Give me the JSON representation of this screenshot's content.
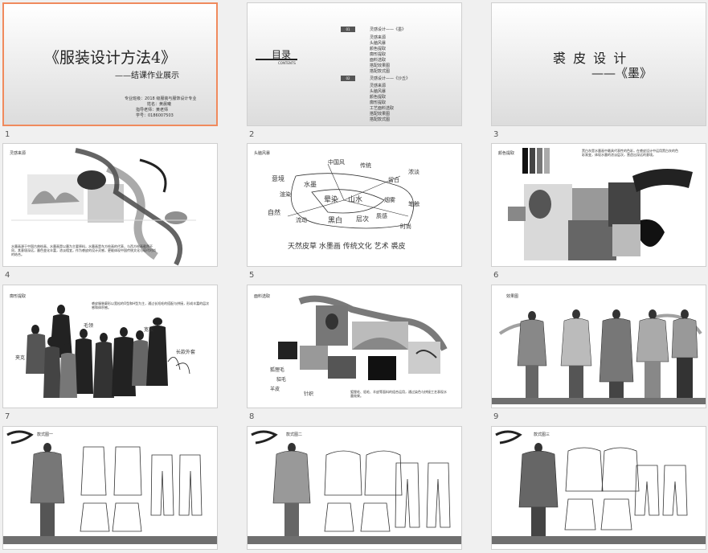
{
  "slides": [
    {
      "number": "1",
      "title": "《服装设计方法4》",
      "subtitle": "——结课作业展示",
      "info": [
        "专业班级：2018 级服装与服饰设计专业",
        "姓名：黄晨曦",
        "指导老师：黄老师",
        "学号：0186007503"
      ]
    },
    {
      "number": "2",
      "toc_title": "目录",
      "toc_en": "CONTENTS",
      "section1_num": "01",
      "section1_title": "灵感设计——《墨》",
      "section1_items": [
        "灵感来源",
        "头脑风暴",
        "颜色提取",
        "廓形提取",
        "面料选取",
        "搭配效果图",
        "搭配款式图"
      ],
      "section2_num": "02",
      "section2_title": "灵感设计——《沙丘》",
      "section2_items": [
        "灵感来源",
        "头脑风暴",
        "颜色提取",
        "廓形提取",
        "工艺面料选取",
        "搭配效果图",
        "搭配款式图"
      ]
    },
    {
      "number": "3",
      "title": "裘 皮 设 计",
      "subtitle": "——《墨》"
    },
    {
      "number": "4",
      "label": "灵感来源",
      "body": "水墨画源于中国古典绘画，水墨画是以墨为主要原料，水墨画是东方绘画的代表，与西方绘画截然不同，其意境深远，墨色变化丰富，浓淡相宜。作为裘皮的设计灵感，更能体现中国传统文化与现代时尚的结合。"
    },
    {
      "number": "5",
      "label": "头脑风暴",
      "words": [
        "意境",
        "水墨",
        "中国风",
        "传统",
        "留白",
        "浓淡",
        "渲染",
        "晕染",
        "山水",
        "烟雾",
        "笔触",
        "自然",
        "流动",
        "黑白",
        "层次",
        "质感",
        "时尚"
      ],
      "bottom_words": "天然皮草  水墨画  传统文化  艺术  裘皮"
    },
    {
      "number": "6",
      "label": "颜色提取",
      "body": "黑白灰是水墨画中最具代表性的色彩，在裘皮设计中运用黑白灰的色彩渐变，体现水墨的浓淡层次，营造出深远的意境。"
    },
    {
      "number": "7",
      "label": "廓形提取",
      "body": "裘皮服装廓形以宽松的O型和H型为主，通过长短毛的搭配与拼接，形成丰富的层次感和体积感。",
      "notes": [
        "毛领",
        "宽松",
        "夹克",
        "长款外套"
      ]
    },
    {
      "number": "8",
      "label": "面料选取",
      "body": "狐狸毛、貂毛、羊皮等面料的组合运用，通过染色与拼接工艺表现水墨效果。",
      "notes": [
        "狐狸毛",
        "貂毛",
        "羊皮",
        "针织"
      ]
    },
    {
      "number": "9",
      "label": "效果图"
    },
    {
      "number": "10",
      "label": "款式图一"
    },
    {
      "number": "11",
      "label": "款式图二"
    },
    {
      "number": "12",
      "label": "款式图三"
    }
  ]
}
